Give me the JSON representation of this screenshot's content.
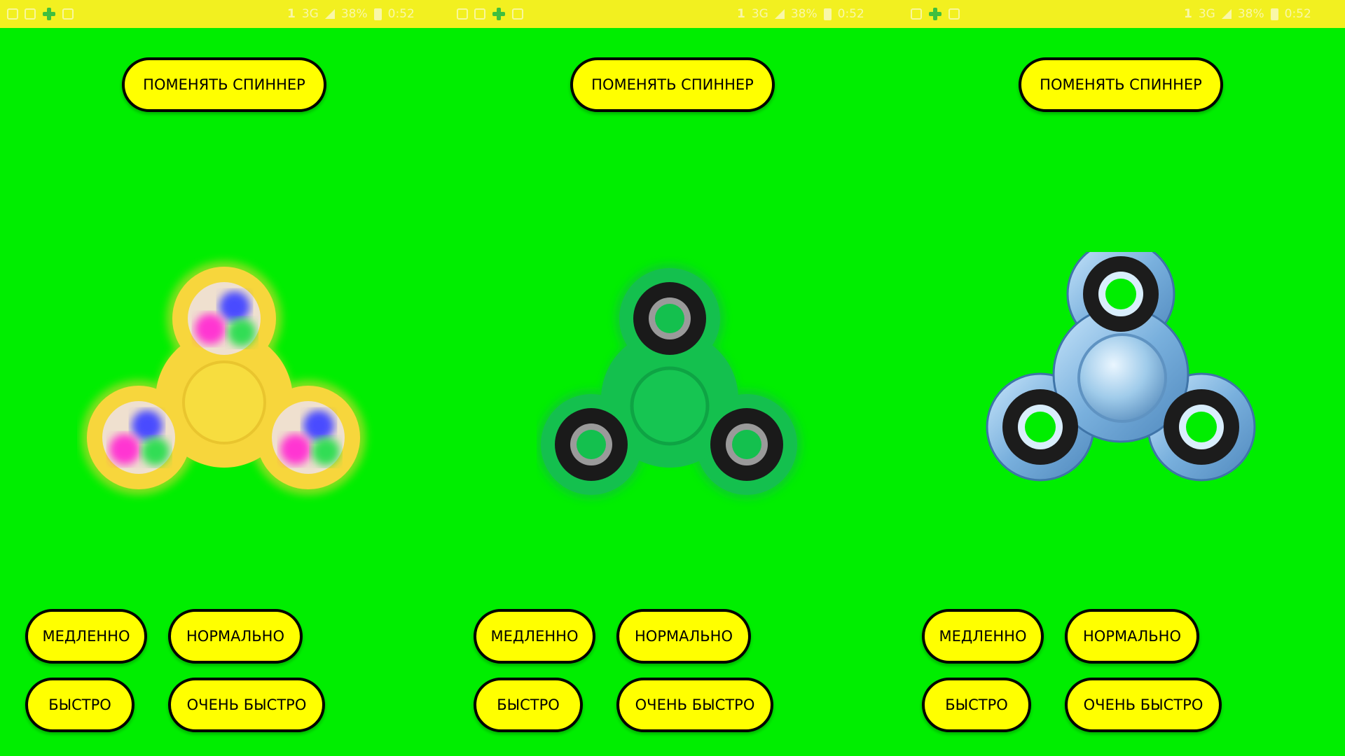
{
  "status_bar": {
    "segments": [
      {
        "right": {
          "sim": "1",
          "network": "3G",
          "battery": "38%",
          "time": "0:52"
        }
      },
      {
        "right": {
          "sim": "1",
          "network": "3G",
          "battery": "38%",
          "time": "0:52"
        }
      },
      {
        "right": {
          "sim": "1",
          "network": "3G",
          "battery": "38%",
          "time": "0:52"
        }
      }
    ]
  },
  "panels": [
    {
      "change_label": "ПОМЕНЯТЬ СПИННЕР",
      "spinner_style": "yellow-led",
      "speed_buttons": {
        "slow": "МЕДЛЕННО",
        "normal": "НОРМАЛЬНО",
        "fast": "БЫСТРО",
        "very_fast": "ОЧЕНЬ БЫСТРО"
      }
    },
    {
      "change_label": "ПОМЕНЯТЬ СПИННЕР",
      "spinner_style": "green",
      "speed_buttons": {
        "slow": "МЕДЛЕННО",
        "normal": "НОРМАЛЬНО",
        "fast": "БЫСТРО",
        "very_fast": "ОЧЕНЬ БЫСТРО"
      }
    },
    {
      "change_label": "ПОМЕНЯТЬ СПИННЕР",
      "spinner_style": "blue-metal",
      "speed_buttons": {
        "slow": "МЕДЛЕННО",
        "normal": "НОРМАЛЬНО",
        "fast": "БЫСТРО",
        "very_fast": "ОЧЕНЬ БЫСТРО"
      }
    }
  ],
  "colors": {
    "background": "#00ee00",
    "status_bar": "#f2f020",
    "button_fill": "#ffff00",
    "button_border": "#000000"
  }
}
